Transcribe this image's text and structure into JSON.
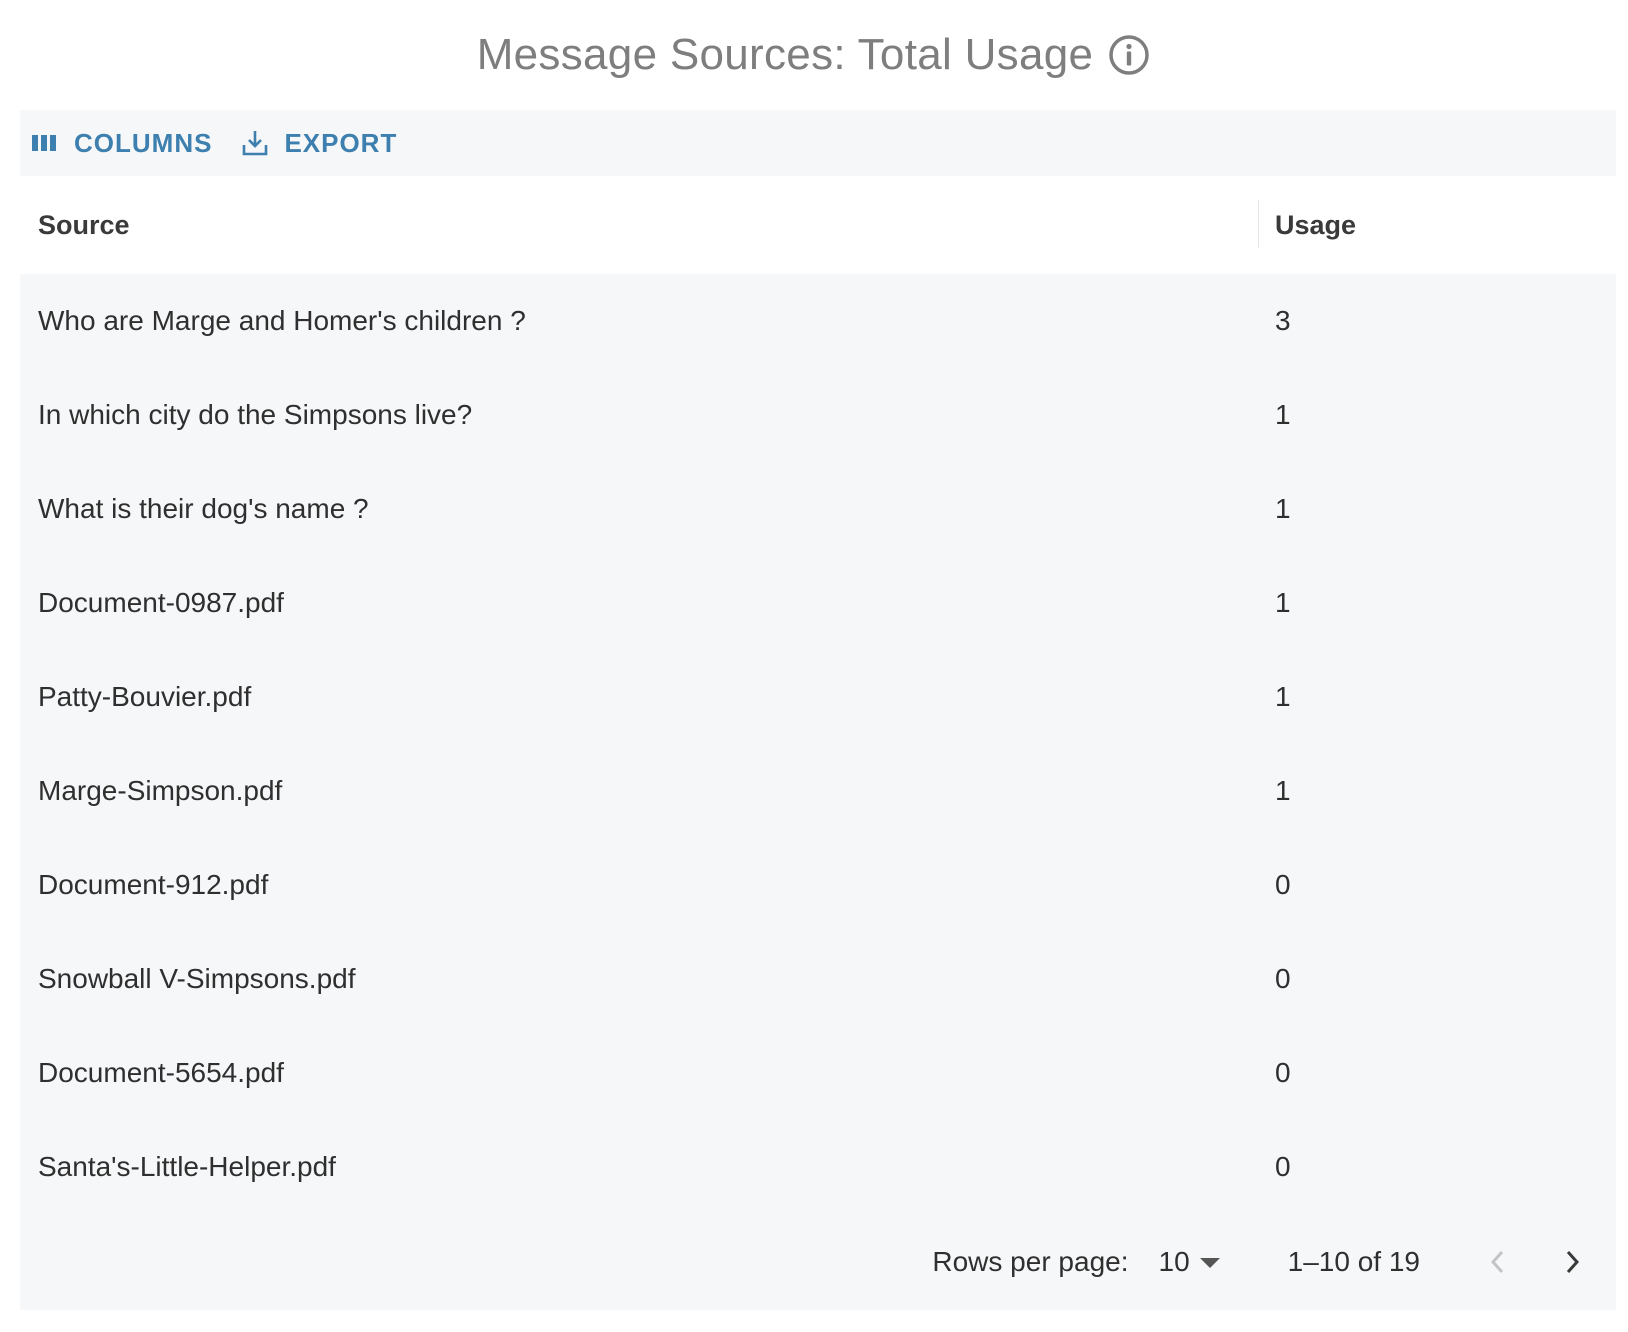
{
  "header": {
    "title": "Message Sources: Total Usage",
    "info_icon": "info-circle-icon"
  },
  "toolbar": {
    "columns_label": "COLUMNS",
    "columns_icon": "view-columns-icon",
    "export_label": "EXPORT",
    "export_icon": "download-icon",
    "accent_color": "#3d7fae"
  },
  "table": {
    "columns": [
      "Source",
      "Usage"
    ],
    "rows": [
      {
        "source": "Who are Marge and Homer's children ?",
        "usage": "3"
      },
      {
        "source": "In which city do the Simpsons live?",
        "usage": "1"
      },
      {
        "source": "What is their dog's name ?",
        "usage": "1"
      },
      {
        "source": "Document-0987.pdf",
        "usage": "1"
      },
      {
        "source": "Patty-Bouvier.pdf",
        "usage": "1"
      },
      {
        "source": "Marge-Simpson.pdf",
        "usage": "1"
      },
      {
        "source": "Document-912.pdf",
        "usage": "0"
      },
      {
        "source": "Snowball V-Simpsons.pdf",
        "usage": "0"
      },
      {
        "source": "Document-5654.pdf",
        "usage": "0"
      },
      {
        "source": "Santa's-Little-Helper.pdf",
        "usage": "0"
      }
    ]
  },
  "pagination": {
    "rows_per_page_label": "Rows per page:",
    "rows_per_page_value": "10",
    "range_text": "1–10 of 19",
    "prev_icon": "chevron-left-icon",
    "next_icon": "chevron-right-icon"
  }
}
